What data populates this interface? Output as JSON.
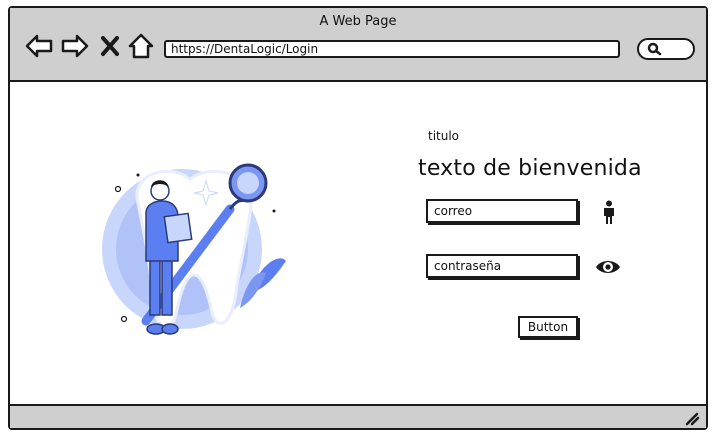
{
  "window": {
    "title": "A Web Page",
    "url": "https://DentaLogic/Login"
  },
  "login": {
    "heading_small": "titulo",
    "welcome": "texto de bienvenida",
    "email_placeholder": "correo",
    "password_placeholder": "contraseña",
    "submit_label": "Button"
  },
  "icons": {
    "back": "arrow-left-icon",
    "forward": "arrow-right-icon",
    "stop": "close-icon",
    "home": "home-icon",
    "search": "search-icon",
    "user": "person-icon",
    "show_password": "eye-icon",
    "resize": "resize-grip-icon"
  },
  "colors": {
    "chrome": "#cfcfcf",
    "outline": "#1a1a1a",
    "illustration_blue": "#5b7ff0",
    "illustration_light": "#c9d6fb"
  }
}
